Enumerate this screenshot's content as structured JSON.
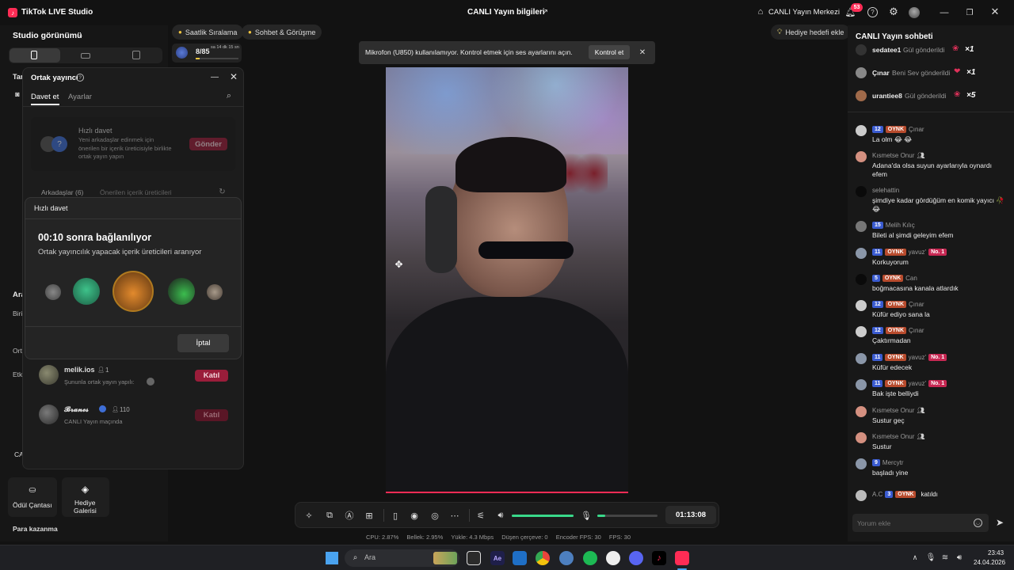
{
  "app": {
    "title": "TikTok LIVE Studio",
    "window_center_title": "CANLI Yayın bilgileri",
    "live_center": "CANLI Yayın Merkezi",
    "notif_count": "53"
  },
  "left": {
    "studio_view": "Studio görünümü",
    "cut_labels": [
      "Tar",
      "Ara",
      "Biri",
      "Ort",
      "Etk",
      "CA"
    ],
    "reward_bag": "Ödül Çantası",
    "gift_gallery_line1": "Hediye",
    "gift_gallery_line2": "Galerisi",
    "earn_money": "Para kazanma"
  },
  "pills": {
    "hourly_rank": "Saatlik Sıralama",
    "chat_meet": "Sohbet & Görüşme",
    "progress": "8/85",
    "time_left": "sa 14 dk 15 sn",
    "gift_goal": "Hediye hedefi ekle"
  },
  "cohost": {
    "title": "Ortak yayıncı",
    "tab_invite": "Davet et",
    "tab_settings": "Ayarlar",
    "quick_invite_title": "Hızlı davet",
    "quick_invite_desc": "Yeni arkadaşlar edinmek için önerilen bir içerik üreticisiyle birlikte ortak yayın yapın",
    "send_button": "Gönder",
    "friends_tab": "Arkadaşlar (6)",
    "suggested_tab": "Önerilen içerik üreticileri",
    "friends": [
      {
        "name": "melik.ios",
        "count": "1",
        "status": "Şununla ortak yayın yapılı:",
        "join": "Katıl"
      },
      {
        "name": "𝓑𝓻𝓪𝓷𝓮𝓼",
        "count": "110",
        "status": "CANLI Yayın maçında",
        "join": "Katıl"
      }
    ]
  },
  "quick_invite_modal": {
    "header": "Hızlı davet",
    "countdown": "00:10 sonra bağlanılıyor",
    "subtitle": "Ortak yayıncılık yapacak içerik üreticileri aranıyor",
    "cancel": "İptal"
  },
  "toast": {
    "message": "Mikrofon (U850) kullanılamıyor. Kontrol etmek için ses ayarlarını açın.",
    "action": "Kontrol et"
  },
  "chat": {
    "title": "CANLI Yayın sohbeti",
    "gifts": [
      {
        "user": "sedatee1",
        "action": "Gül gönderildi",
        "multiplier": "×1"
      },
      {
        "user": "Çınar",
        "action": "Beni Sev gönderildi",
        "multiplier": "×1"
      },
      {
        "user": "urantiee8",
        "action": "Gül gönderildi",
        "multiplier": "×5"
      }
    ],
    "messages": [
      {
        "user": "Çınar",
        "level": "12",
        "fan": "OYNK",
        "text": "La olm 😂 😂"
      },
      {
        "user": "Kısmetse Onur",
        "text": "Adana'da olsa suyun ayarlarıyla oynardı efem"
      },
      {
        "user": "selehattin",
        "text": "şimdiye kadar gördüğüm en komik yayıcı 🥀 😂"
      },
      {
        "user": "Melih Kılıç",
        "level": "15",
        "text": "Bileti al şimdi geleyim efem"
      },
      {
        "user": "yavuz'",
        "level": "11",
        "fan": "OYNK",
        "rank": "No. 1",
        "text": "Korkuyorum"
      },
      {
        "user": "Can",
        "level": "5",
        "fan": "OYNK",
        "text": "boğmacasına kanala atlardık"
      },
      {
        "user": "Çınar",
        "level": "12",
        "fan": "OYNK",
        "text": "Küfür ediyo sana la"
      },
      {
        "user": "Çınar",
        "level": "12",
        "fan": "OYNK",
        "text": "Çaktırmadan"
      },
      {
        "user": "yavuz'",
        "level": "11",
        "fan": "OYNK",
        "rank": "No. 1",
        "text": "Küfür edecek"
      },
      {
        "user": "yavuz'",
        "level": "11",
        "fan": "OYNK",
        "rank": "No. 1",
        "text": "Bak işte belliydi"
      },
      {
        "user": "Kısmetse Onur",
        "text": "Sustur geç"
      },
      {
        "user": "Kısmetse Onur",
        "text": "Sustur"
      },
      {
        "user": "Mercytr",
        "level": "9",
        "text": "başladı yine"
      }
    ],
    "join": {
      "user": "A.C",
      "level": "3",
      "fan": "OYNK",
      "text": "katıldı"
    },
    "input_placeholder": "Yorum ekle"
  },
  "controls": {
    "timer": "01:13:08"
  },
  "stats": {
    "cpu": "CPU: 2.87%",
    "memory": "Bellek: 2.95%",
    "upload": "Yükle: 4.3 Mbps",
    "dropped": "Düşen çerçeve: 0",
    "encoder_fps": "Encoder FPS: 30",
    "fps": "FPS: 30"
  },
  "taskbar": {
    "search": "Ara",
    "time": "23:43",
    "date": "24.04.2026"
  },
  "colors": {
    "accent_red": "#fe2c55",
    "send_button": "#9a1d3a",
    "slider": "#39d98a"
  }
}
